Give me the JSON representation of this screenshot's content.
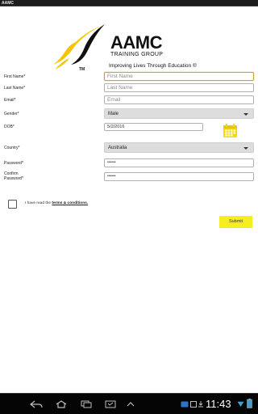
{
  "app": {
    "title": "AAMC"
  },
  "logo": {
    "name": "AAMC",
    "subtitle": "TRAINING GROUP",
    "tm": "TM",
    "tagline": "Improving Lives Through Education ®"
  },
  "form": {
    "first_name": {
      "label": "First Name*",
      "placeholder": "First Name",
      "value": ""
    },
    "last_name": {
      "label": "Last Name*",
      "placeholder": "Last Name",
      "value": ""
    },
    "email": {
      "label": "Email*",
      "placeholder": "Email",
      "value": ""
    },
    "gender": {
      "label": "Gender*",
      "selected": "Male"
    },
    "dob": {
      "label": "DOB*",
      "value": "5/2/2016"
    },
    "country": {
      "label": "Country*",
      "selected": "Australia"
    },
    "password": {
      "label": "Password*",
      "value": "••••••"
    },
    "confirm_password": {
      "label_line1": "Confirm",
      "label_line2": "Password*",
      "value": "••••••"
    },
    "terms": {
      "prefix": "I have read the ",
      "link": "terms & conditions."
    },
    "submit_label": "Submit"
  },
  "statusbar": {
    "time": "11:43"
  },
  "colors": {
    "accent": "#f6ee1f",
    "focus": "#c8a434",
    "logo_yellow": "#f5c400"
  }
}
